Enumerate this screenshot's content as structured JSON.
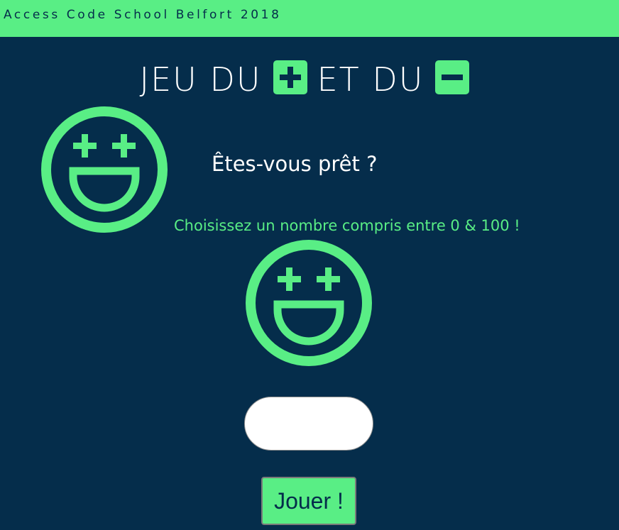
{
  "header": {
    "brand": "Access Code School Belfort 2018"
  },
  "title": {
    "part1": "JEU DU",
    "part2": "ET DU",
    "plus_icon": "plus-square-icon",
    "minus_icon": "minus-square-icon"
  },
  "game": {
    "ready_text": "Êtes-vous prêt ?",
    "instructions": "Choisissez un nombre compris entre 0 & 100 !",
    "smiley_icon": "smiley-plus-eyes-icon",
    "input_value": "",
    "input_placeholder": "",
    "play_button_label": "Jouer !"
  },
  "colors": {
    "background": "#052d4b",
    "accent": "#59ee85",
    "text": "#ffffff"
  }
}
